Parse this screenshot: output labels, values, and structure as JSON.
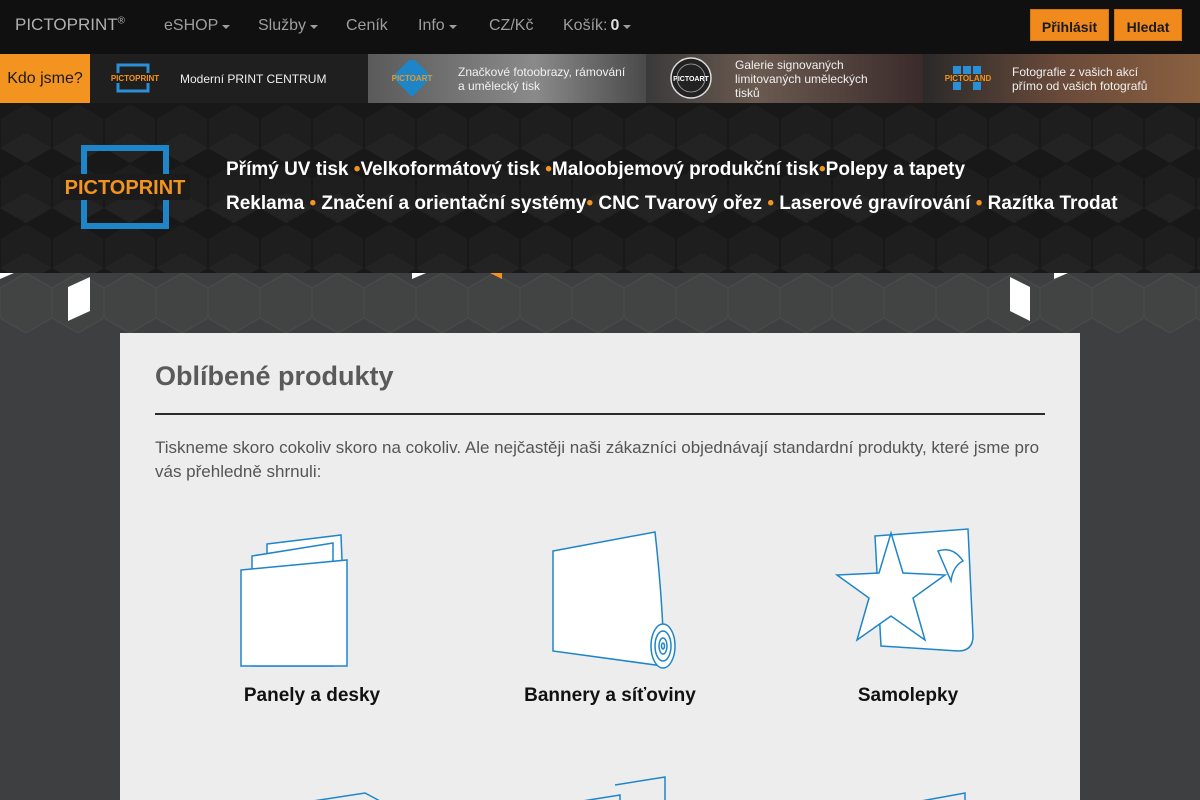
{
  "navbar": {
    "brand": "PICTOPRINT",
    "brand_mark": "®",
    "items": [
      {
        "label": "eSHOP",
        "dropdown": true
      },
      {
        "label": "Služby",
        "dropdown": true
      },
      {
        "label": "Ceník",
        "dropdown": false
      },
      {
        "label": "Info",
        "dropdown": true
      },
      {
        "label": "CZ/Kč",
        "dropdown": false
      }
    ],
    "cart_label": "Košík: ",
    "cart_count": "0",
    "login_label": "Přihlásit",
    "search_label": "Hledat"
  },
  "subbar": {
    "about_label": "Kdo jsme?",
    "items": [
      {
        "logo": "PICTOPRINT",
        "text": "Moderní PRINT CENTRUM"
      },
      {
        "logo": "PICTOART",
        "text": "Značkové fotoobrazy, rámování a umělecký tisk"
      },
      {
        "logo": "PICTOART",
        "text": "Galerie signovaných limitovaných uměleckých tisků"
      },
      {
        "logo": "PICTOLAND",
        "text": "Fotografie z vašich akcí přímo od vašich fotografů"
      }
    ]
  },
  "hero": {
    "logo_text": "PICTOPRINT",
    "links": [
      "Přímý UV tisk",
      "Velkoformátový tisk",
      "Maloobjemový produkční tisk",
      "Polepy a tapety",
      "Reklama",
      "Značení a orientační systémy",
      "CNC Tvarový ořez",
      "Laserové gravírování",
      "Razítka Trodat"
    ],
    "separator": "•"
  },
  "products": {
    "title": "Oblíbené produkty",
    "intro": "Tiskneme skoro cokoliv skoro na cokoliv. Ale nejčastěji naši zákazníci objednávají standardní produkty, které jsme pro vás přehledně shrnuli:",
    "items": [
      {
        "label": "Panely a desky",
        "icon": "panels-icon"
      },
      {
        "label": "Bannery a síťoviny",
        "icon": "banner-roll-icon"
      },
      {
        "label": "Samolepky",
        "icon": "sticker-star-icon"
      }
    ]
  },
  "colors": {
    "accent": "#f39420",
    "icon_stroke": "#1e86c8"
  }
}
